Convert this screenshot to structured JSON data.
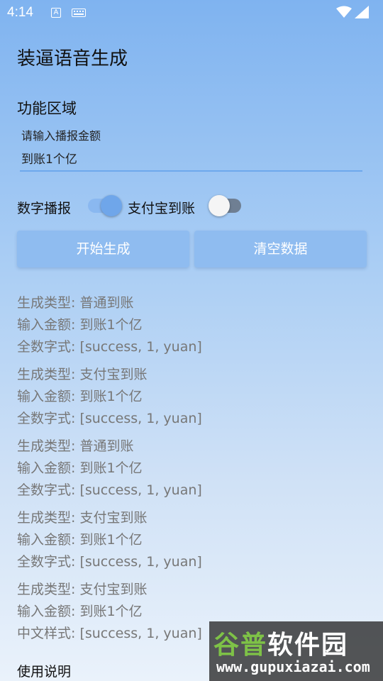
{
  "status_bar": {
    "time": "4:14",
    "icons": [
      "a-icon",
      "keyboard-icon",
      "wifi-icon",
      "signal-icon"
    ]
  },
  "app": {
    "title": "装逼语音生成"
  },
  "function_section": {
    "title": "功能区域",
    "amount_hint": "请输入播报金额",
    "amount_value": "到账1个亿"
  },
  "switches": {
    "number_broadcast_label": "数字播报",
    "number_broadcast_on": true,
    "alipay_label": "支付宝到账",
    "alipay_on": false
  },
  "buttons": {
    "generate_label": "开始生成",
    "clear_label": "清空数据"
  },
  "results": [
    {
      "type": "生成类型: 普通到账",
      "amount": "输入金额: 到账1个亿",
      "format": "全数字式: [success, 1, yuan]"
    },
    {
      "type": "生成类型: 支付宝到账",
      "amount": "输入金额: 到账1个亿",
      "format": "全数字式: [success, 1, yuan]"
    },
    {
      "type": "生成类型: 普通到账",
      "amount": "输入金额: 到账1个亿",
      "format": "全数字式: [success, 1, yuan]"
    },
    {
      "type": "生成类型: 支付宝到账",
      "amount": "输入金额: 到账1个亿",
      "format": "全数字式: [success, 1, yuan]"
    },
    {
      "type": "生成类型: 支付宝到账",
      "amount": "输入金额: 到账1个亿",
      "format": "中文样式: [success, 1, yuan]"
    }
  ],
  "usage": {
    "title": "使用说明"
  },
  "watermark": {
    "main_a": "谷普",
    "main_b": "软件园",
    "url": "www.gupuxiazai.com"
  },
  "colors": {
    "accent": "#8fbcf0",
    "text_muted": "#777777"
  }
}
